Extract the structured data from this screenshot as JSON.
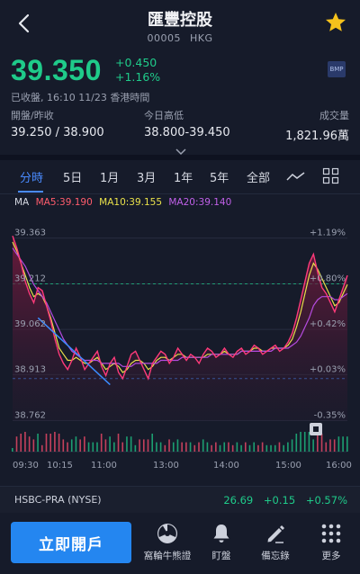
{
  "header": {
    "title": "匯豐控股",
    "code": "00005",
    "market": "HKG"
  },
  "quote": {
    "price": "39.350",
    "change": "+0.450",
    "change_pct": "+1.16%",
    "badge": "BMP",
    "status": "已收盤, 16:10 11/23 香港時間"
  },
  "stats": {
    "open_prev_label": "開盤/昨收",
    "open_prev_value": "39.250 / 38.900",
    "range_label": "今日高低",
    "range_value": "38.800-39.450",
    "volume_label": "成交量",
    "volume_value": "1,821.96萬"
  },
  "tabs": [
    {
      "label": "分時"
    },
    {
      "label": "5日"
    },
    {
      "label": "1月"
    },
    {
      "label": "3月"
    },
    {
      "label": "1年"
    },
    {
      "label": "5年"
    },
    {
      "label": "全部"
    }
  ],
  "ma_legend": {
    "ma": "MA",
    "ma5": "MA5:39.190",
    "ma10": "MA10:39.155",
    "ma20": "MA20:39.140"
  },
  "chart_data": {
    "type": "line",
    "y_left_ticks": [
      "39.363",
      "39.212",
      "39.062",
      "38.913",
      "38.762"
    ],
    "y_right_ticks": [
      "+1.19%",
      "+0.80%",
      "+0.42%",
      "+0.03%",
      "-0.35%"
    ],
    "x_ticks": [
      "09:30",
      "10:15",
      "11:00",
      "13:00",
      "14:00",
      "15:00",
      "16:00"
    ],
    "prev_close": 38.9,
    "ylim": [
      38.76,
      39.43
    ],
    "price_series": [
      39.37,
      39.33,
      39.28,
      39.22,
      39.18,
      39.15,
      39.2,
      39.19,
      39.14,
      39.09,
      39.03,
      38.98,
      38.95,
      38.93,
      38.96,
      39.0,
      38.97,
      38.93,
      38.95,
      38.97,
      38.99,
      38.94,
      38.91,
      38.95,
      38.97,
      38.92,
      38.9,
      38.94,
      38.98,
      38.99,
      38.96,
      38.93,
      38.9,
      38.95,
      38.97,
      38.99,
      38.98,
      38.95,
      38.97,
      39.0,
      38.98,
      38.96,
      38.98,
      38.97,
      38.95,
      38.98,
      39.0,
      38.99,
      38.97,
      38.98,
      39.0,
      38.98,
      38.97,
      38.99,
      39.0,
      38.98,
      38.99,
      39.01,
      39.0,
      38.98,
      38.99,
      39.0,
      39.01,
      38.99,
      39.0,
      39.02,
      39.05,
      39.1,
      39.16,
      39.22,
      39.28,
      39.31,
      39.25,
      39.2,
      39.18,
      39.15,
      39.12,
      39.16,
      39.2,
      39.24
    ],
    "ma_series": [
      {
        "name": "MA5",
        "color": "#e8e04a",
        "values": [
          39.35,
          39.32,
          39.28,
          39.24,
          39.2,
          39.17,
          39.18,
          39.17,
          39.14,
          39.1,
          39.05,
          39.0,
          38.98,
          38.96,
          38.96,
          38.97,
          38.96,
          38.95,
          38.95,
          38.96,
          38.97,
          38.95,
          38.93,
          38.94,
          38.95,
          38.94,
          38.92,
          38.93,
          38.95,
          38.96,
          38.96,
          38.95,
          38.93,
          38.94,
          38.96,
          38.97,
          38.97,
          38.96,
          38.97,
          38.98,
          38.98,
          38.97,
          38.97,
          38.97,
          38.97,
          38.97,
          38.98,
          38.98,
          38.98,
          38.98,
          38.99,
          38.98,
          38.98,
          38.98,
          38.99,
          38.99,
          38.99,
          39.0,
          39.0,
          38.99,
          38.99,
          39.0,
          39.0,
          39.0,
          39.0,
          39.01,
          39.03,
          39.07,
          39.12,
          39.18,
          39.24,
          39.28,
          39.26,
          39.23,
          39.2,
          39.17,
          39.14,
          39.15,
          39.18,
          39.21
        ]
      },
      {
        "name": "MA20",
        "color": "#b54be0",
        "values": [
          39.33,
          39.31,
          39.29,
          39.27,
          39.24,
          39.21,
          39.19,
          39.17,
          39.15,
          39.12,
          39.09,
          39.06,
          39.03,
          39.01,
          38.99,
          38.98,
          38.97,
          38.96,
          38.96,
          38.96,
          38.96,
          38.95,
          38.95,
          38.95,
          38.95,
          38.95,
          38.94,
          38.94,
          38.94,
          38.95,
          38.95,
          38.95,
          38.95,
          38.95,
          38.95,
          38.96,
          38.96,
          38.96,
          38.96,
          38.96,
          38.97,
          38.97,
          38.97,
          38.97,
          38.97,
          38.97,
          38.97,
          38.98,
          38.98,
          38.98,
          38.98,
          38.98,
          38.98,
          38.98,
          38.99,
          38.99,
          38.99,
          38.99,
          38.99,
          38.99,
          38.99,
          38.99,
          39.0,
          39.0,
          39.0,
          39.0,
          39.01,
          39.02,
          39.04,
          39.07,
          39.1,
          39.14,
          39.16,
          39.17,
          39.17,
          39.17,
          39.16,
          39.16,
          39.17,
          39.18
        ]
      }
    ],
    "trend_line": {
      "color": "#3b8cff",
      "from": [
        6,
        39.1
      ],
      "to": [
        23,
        38.88
      ]
    }
  },
  "ticker": {
    "name": "HSBC-PRA (NYSE)",
    "price": "26.69",
    "change": "+0.15",
    "change_pct": "+0.57%"
  },
  "bottom_nav": {
    "open_account": "立即開戶",
    "items": [
      {
        "label": "窩輪牛熊證",
        "icon": "warrant-icon"
      },
      {
        "label": "盯盤",
        "icon": "bell-icon"
      },
      {
        "label": "備忘錄",
        "icon": "pencil-icon"
      },
      {
        "label": "更多",
        "icon": "grid-dots-icon"
      }
    ]
  },
  "colors": {
    "up": "#1fcb8a",
    "accent": "#4a8bff",
    "price_line": "#ff3a7a",
    "star": "#f6c21c"
  }
}
